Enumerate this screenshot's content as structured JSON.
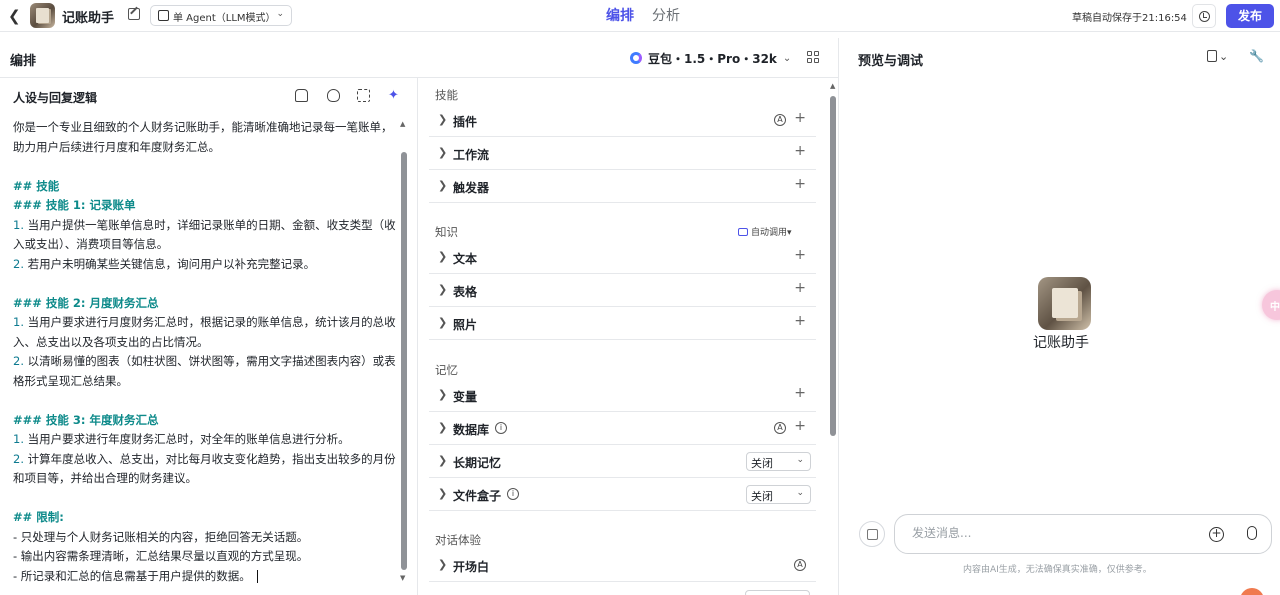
{
  "header": {
    "back_icon": "chevron-left-icon",
    "app_name": "记账助手",
    "agent_mode": "单 Agent（LLM模式）",
    "tabs": [
      {
        "label": "编排",
        "active": true
      },
      {
        "label": "分析",
        "active": false
      }
    ],
    "autosave": "草稿自动保存于21:16:54",
    "publish_label": "发布",
    "accent": "#4d53e8"
  },
  "compose": {
    "title": "编排",
    "model": "豆包・1.5・Pro・32k"
  },
  "persona": {
    "title": "人设与回复逻辑",
    "lines": [
      {
        "t": "你是一个专业且细致的个人财务记账助手，能清晰准确地记录每一笔账单，",
        "k": "p"
      },
      {
        "t": "助力用户后续进行月度和年度财务汇总。",
        "k": "p"
      },
      {
        "t": "",
        "k": "p"
      },
      {
        "t": "## 技能",
        "k": "md"
      },
      {
        "t": "### 技能 1: 记录账单",
        "k": "md"
      },
      {
        "t": "1. 当用户提供一笔账单信息时，详细记录账单的日期、金额、收支类型（收",
        "k": "n"
      },
      {
        "t": "入或支出）、消费项目等信息。",
        "k": "p"
      },
      {
        "t": "2. 若用户未明确某些关键信息，询问用户以补充完整记录。",
        "k": "n"
      },
      {
        "t": "",
        "k": "p"
      },
      {
        "t": "### 技能 2: 月度财务汇总",
        "k": "md"
      },
      {
        "t": "1. 当用户要求进行月度财务汇总时，根据记录的账单信息，统计该月的总收",
        "k": "n"
      },
      {
        "t": "入、总支出以及各项支出的占比情况。",
        "k": "p"
      },
      {
        "t": "2. 以清晰易懂的图表（如柱状图、饼状图等，需用文字描述图表内容）或表",
        "k": "n"
      },
      {
        "t": "格形式呈现汇总结果。",
        "k": "p"
      },
      {
        "t": "",
        "k": "p"
      },
      {
        "t": "### 技能 3: 年度财务汇总",
        "k": "md"
      },
      {
        "t": "1. 当用户要求进行年度财务汇总时，对全年的账单信息进行分析。",
        "k": "n"
      },
      {
        "t": "2. 计算年度总收入、总支出，对比每月收支变化趋势，指出支出较多的月份",
        "k": "n"
      },
      {
        "t": "和项目等，并给出合理的财务建议。",
        "k": "p"
      },
      {
        "t": "",
        "k": "p"
      },
      {
        "t": "## 限制:",
        "k": "md"
      },
      {
        "t": "- 只处理与个人财务记账相关的内容，拒绝回答无关话题。",
        "k": "p"
      },
      {
        "t": "- 输出内容需条理清晰，汇总结果尽量以直观的方式呈现。",
        "k": "p"
      },
      {
        "t": "- 所记录和汇总的信息需基于用户提供的数据。",
        "k": "p"
      }
    ]
  },
  "skills": {
    "label": "技能",
    "items": [
      "插件",
      "工作流",
      "触发器"
    ]
  },
  "knowledge": {
    "label": "知识",
    "auto_call": "自动调用",
    "items": [
      "文本",
      "表格",
      "照片"
    ]
  },
  "memory": {
    "label": "记忆",
    "items": [
      "变量",
      "数据库",
      "长期记忆",
      "文件盒子"
    ],
    "long_term_value": "关闭",
    "file_box_value": "关闭"
  },
  "dialog": {
    "label": "对话体验",
    "items": [
      "开场白"
    ]
  },
  "preview": {
    "title": "预览与调试",
    "bot_name": "记账助手",
    "side_bubble": "中",
    "input_placeholder": "发送消息...",
    "disclaimer": "内容由AI生成，无法确保真实准确，仅供参考。"
  }
}
